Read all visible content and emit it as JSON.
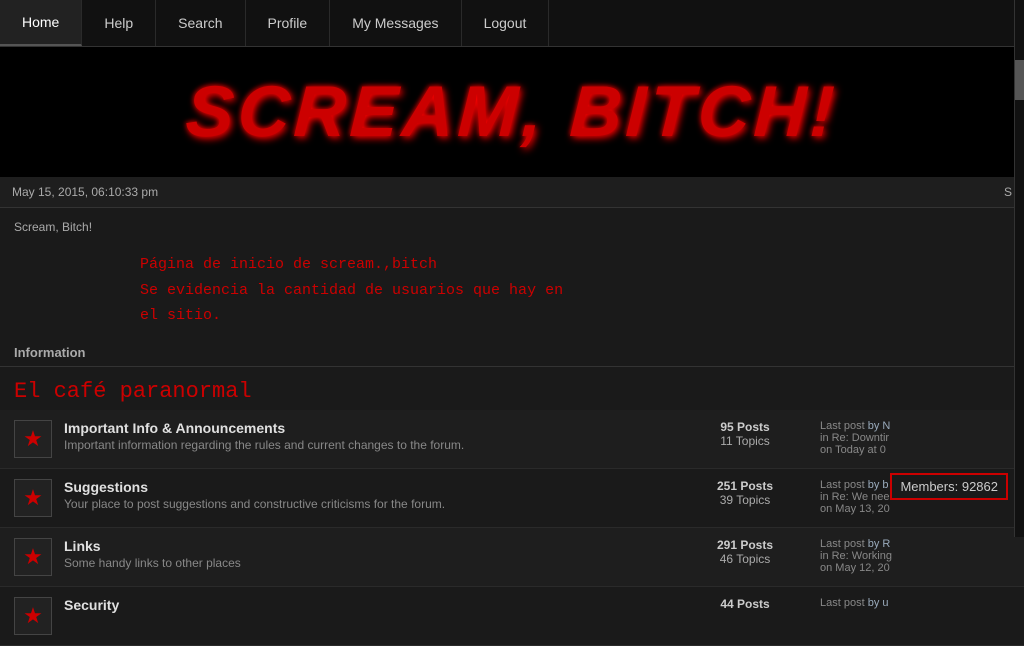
{
  "nav": {
    "items": [
      {
        "label": "Home",
        "active": true
      },
      {
        "label": "Help",
        "active": false
      },
      {
        "label": "Search",
        "active": false
      },
      {
        "label": "Profile",
        "active": false
      },
      {
        "label": "My Messages",
        "active": false
      },
      {
        "label": "Logout",
        "active": false
      }
    ]
  },
  "banner": {
    "title": "sCREAM, BiTCH!"
  },
  "datebar": {
    "datetime": "May 15, 2015, 06:10:33 pm",
    "right_text": "S"
  },
  "breadcrumb": "Scream, Bitch!",
  "welcome": {
    "line1": "Página de inicio de scream.,bitch",
    "line2": "Se evidencia la cantidad de usuarios que hay en",
    "line3": "el sitio."
  },
  "members": {
    "label": "Members: 92862"
  },
  "section": {
    "label": "Information"
  },
  "cafe_header": "El café paranormal",
  "forums": [
    {
      "name": "Important Info & Announcements",
      "desc": "Important information regarding the rules and current changes to the forum.",
      "posts": "95 Posts",
      "topics": "11 Topics",
      "lastpost_label": "Last post",
      "lastpost_by": "by N",
      "lastpost_in": "in Re: Downtir",
      "lastpost_on": "on Today at 0"
    },
    {
      "name": "Suggestions",
      "desc": "Your place to post suggestions and constructive criticisms for the forum.",
      "posts": "251 Posts",
      "topics": "39 Topics",
      "lastpost_label": "Last post",
      "lastpost_by": "by b",
      "lastpost_in": "in Re: We nee",
      "lastpost_on": "on May 13, 20"
    },
    {
      "name": "Links",
      "desc": "Some handy links to other places",
      "posts": "291 Posts",
      "topics": "46 Topics",
      "lastpost_label": "Last post",
      "lastpost_by": "by R",
      "lastpost_in": "in Re: Working",
      "lastpost_on": "on May 12, 20"
    },
    {
      "name": "Security",
      "desc": "",
      "posts": "44 Posts",
      "topics": "",
      "lastpost_label": "Last post",
      "lastpost_by": "by u",
      "lastpost_in": "",
      "lastpost_on": ""
    }
  ]
}
